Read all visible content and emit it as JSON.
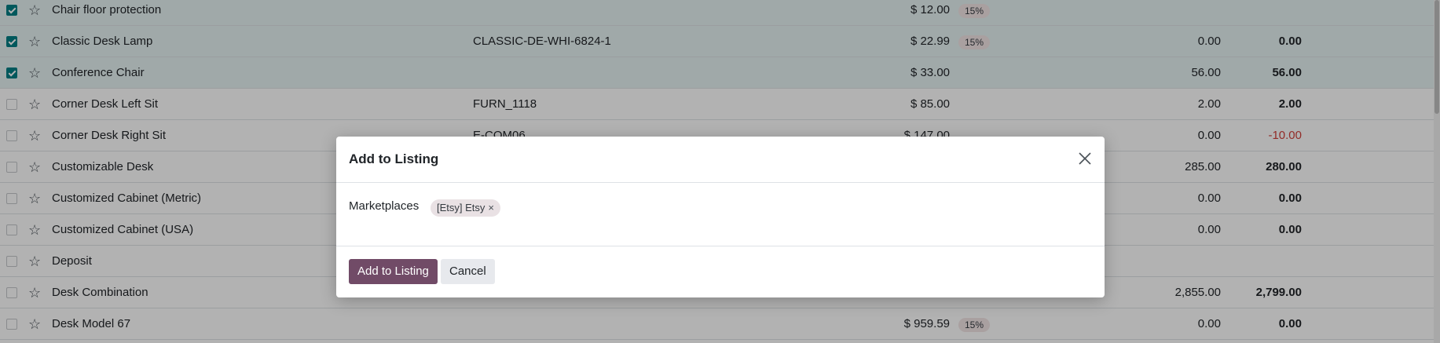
{
  "list": {
    "rows": [
      {
        "checked": true,
        "name": "Chair floor protection",
        "ref": "",
        "price": "$ 12.00",
        "tax": "15%",
        "on_hand": "",
        "forecast": ""
      },
      {
        "checked": true,
        "name": "Classic Desk Lamp",
        "ref": "CLASSIC-DE-WHI-6824-1",
        "price": "$ 22.99",
        "tax": "15%",
        "on_hand": "0.00",
        "forecast": "0.00"
      },
      {
        "checked": true,
        "name": "Conference Chair",
        "ref": "",
        "price": "$ 33.00",
        "tax": "",
        "on_hand": "56.00",
        "forecast": "56.00"
      },
      {
        "checked": false,
        "name": "Corner Desk Left Sit",
        "ref": "FURN_1118",
        "price": "$ 85.00",
        "tax": "",
        "on_hand": "2.00",
        "forecast": "2.00"
      },
      {
        "checked": false,
        "name": "Corner Desk Right Sit",
        "ref": "E-COM06",
        "price": "$ 147.00",
        "tax": "",
        "on_hand": "0.00",
        "forecast": "-10.00",
        "forecast_negative": true
      },
      {
        "checked": false,
        "name": "Customizable Desk",
        "ref": "",
        "price": "",
        "tax": "",
        "on_hand": "285.00",
        "forecast": "280.00"
      },
      {
        "checked": false,
        "name": "Customized Cabinet (Metric)",
        "ref": "",
        "price": "",
        "tax": "",
        "on_hand": "0.00",
        "forecast": "0.00"
      },
      {
        "checked": false,
        "name": "Customized Cabinet (USA)",
        "ref": "",
        "price": "",
        "tax": "",
        "on_hand": "0.00",
        "forecast": "0.00"
      },
      {
        "checked": false,
        "name": "Deposit",
        "ref": "",
        "price": "",
        "tax": "",
        "on_hand": "",
        "forecast": ""
      },
      {
        "checked": false,
        "name": "Desk Combination",
        "ref": "",
        "price": "",
        "tax": "",
        "on_hand": "2,855.00",
        "forecast": "2,799.00"
      },
      {
        "checked": false,
        "name": "Desk Model 67",
        "ref": "",
        "price": "$ 959.59",
        "tax": "15%",
        "on_hand": "0.00",
        "forecast": "0.00"
      }
    ]
  },
  "dialog": {
    "title": "Add to Listing",
    "field_label": "Marketplaces",
    "tag_label": "[Etsy] Etsy",
    "tag_remove": "×",
    "primary_button": "Add to Listing",
    "secondary_button": "Cancel"
  },
  "colors": {
    "primary": "#714b67",
    "checkbox_checked": "#017e84",
    "negative": "#d23f3a"
  }
}
